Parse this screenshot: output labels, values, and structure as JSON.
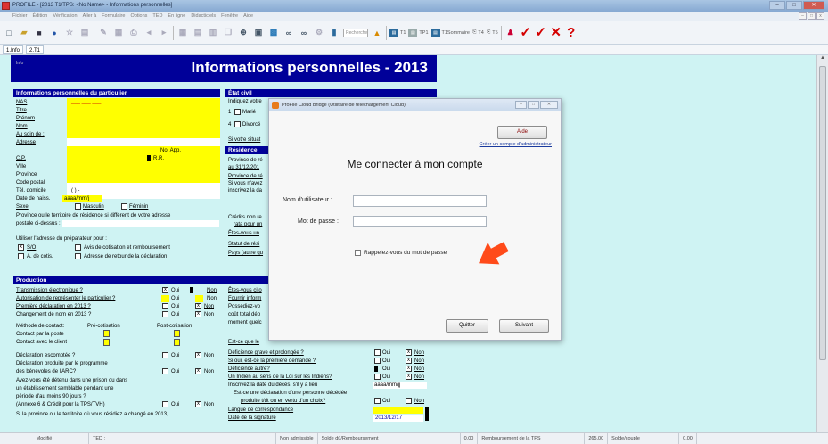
{
  "window": {
    "title": "PROFILE - [2013 T1/TPS: <No Name> - Informations personnelles]",
    "controls": [
      "–",
      "□",
      "✕"
    ]
  },
  "menu": [
    "Fichier",
    "Édition",
    "Vérification",
    "Aller à",
    "Formulaire",
    "Options",
    "TED",
    "En ligne",
    "Didacticiels",
    "Fenêtre",
    "Aide"
  ],
  "toolbar": {
    "search_placeholder": "Recherche",
    "t1": "T1",
    "tp1": "TP1",
    "t1sommaire": "T1Sommaire",
    "t4": "T4",
    "t5": "T5",
    "check_symbol": "✓",
    "x_symbol": "✕",
    "help_symbol": "?",
    "colors": {
      "check": "#d40000",
      "help": "#d40000"
    }
  },
  "tabs": [
    "1.Info",
    "2.T1"
  ],
  "form": {
    "info_label": "Info",
    "heading": "Informations personnelles - 2013",
    "section_personal": "Informations personnelles du particulier",
    "section_civil": "État civil",
    "fields": {
      "nas": "NAS",
      "nas_mask": "___ ___ ___",
      "titre": "Titre",
      "prenom": "Prénom",
      "nom": "Nom",
      "au_soin_de": "Au soin de :",
      "adresse": "Adresse",
      "no_app": "No. App.",
      "cp": "C.P.",
      "rr": "R.R.",
      "ville": "Ville",
      "province": "Province",
      "code_postal": "Code postal",
      "tel_domicile": "Tél. domicile",
      "tel_mask": "( )   -",
      "date_naiss": "Date de naiss.",
      "date_mask": "aaaa/mm/j",
      "sexe": "Sexe",
      "masculin": "Masculin",
      "feminin": "Féminin",
      "province_note_1": "Province ou le territoire de résidence si différent de votre adresse",
      "province_note_2": "postale ci-dessus :",
      "prep_addr": "Utiliser l'adresse du préparateur pour :",
      "so": "S/O",
      "avis": "Avis de cotisation et remboursement",
      "a_de_cotis": "A. de cotis.",
      "adr_retour": "Adresse de retour de la déclaration"
    },
    "civil": {
      "indiquez": "Indiquez votre",
      "marie": "Marié",
      "divorce": "Divorcé",
      "si_votre": "Si votre situat",
      "num1": "1",
      "num4": "4"
    },
    "section_residence": "Résidence",
    "residence": [
      "Province de ré",
      "au 31/12/201",
      "Province de ré",
      "Si vous n'avez",
      "inscrivez la da"
    ],
    "credits": [
      "Crédits non re",
      "rata pour un",
      "Êtes-vous un",
      "Statut de rési",
      "Pays (autre qu"
    ],
    "section_production": "Production",
    "production": {
      "transmission": "Transmission électronique ?",
      "autorisation": "Autorisation de représenter le particulier ?",
      "premiere": "Première déclaration en 2013 ?",
      "changement": "Changement de nom en 2013 ?",
      "oui": "Oui",
      "non": "Non",
      "methode": "Méthode de contact:",
      "pre": "Pré-cotisation",
      "post": "Post-cotisation",
      "contact_poste": "Contact par la poste",
      "contact_client": "Contact avec le client",
      "decl_escomptee": "Déclaration escomptée ?",
      "decl_produite": "Déclaration produite par le programme",
      "des_benevoles": "des bénévoles de l'ARC?",
      "detenu_1": "Avez-vous été détenu dans une prison ou dans",
      "detenu_2": "un établissement semblable pendant une",
      "detenu_3": "période d'au moins 90 jours ?",
      "annexe": "(Annexe 6 & Crédit pour la TPS/TVH)",
      "si_province": "Si la province ou le territoire où vous résidiez a changé en 2013,"
    },
    "right_col": {
      "etes_vous": "Êtes-vous cito",
      "fournir": "Fournir inform",
      "possedez": "Possédiez-vo",
      "cout": "coût total dép",
      "moment": "moment quelc",
      "est_ce": "Est-ce que le",
      "deficience": "Déficience grave et prolongée ?",
      "si_oui": "Si oui, est-ce la première demande ?",
      "deficience_autre": "Déficience autre?",
      "indien": "Un Indien au sens de la Loi sur les Indiens?",
      "inscrivez_deces": "Inscrivez la date du décès, s'il y a lieu",
      "deces_mask": "aaaa/mm/jj",
      "decl_personne_1": "Est-ce une déclaration d'une personne décédée",
      "decl_personne_2": "produite t/dt ou en vertu d'un choix?",
      "langue": "Langue de correspondance",
      "date_signature": "Date de la signature",
      "date_signature_value": "2013/12/17"
    }
  },
  "dialog": {
    "title": "ProFile Cloud Bridge (Utilitaire de téléchargement Cloud)",
    "aide": "Aide",
    "create_link": "Créer un compte d'administrateur",
    "heading": "Me connecter à mon compte",
    "username_label": "Nom d'utilisateur :",
    "username_value": "",
    "password_label": "Mot de passe :",
    "password_value": "",
    "remember": "Rappelez-vous du mot de passe",
    "quit": "Quitter",
    "next": "Suivant",
    "pointer_color": "#ff4b1a"
  },
  "status": {
    "modifie": "Modifié",
    "ted": "TED :",
    "admissible": "Non admissible",
    "solde": "Solde dû/Remboursement",
    "remb_amount": "0,00",
    "remb_tps": "Remboursement de la TPS",
    "couple_amount": "265,00",
    "solde_couple": "Solde/couple",
    "right_amount": "0,00"
  }
}
